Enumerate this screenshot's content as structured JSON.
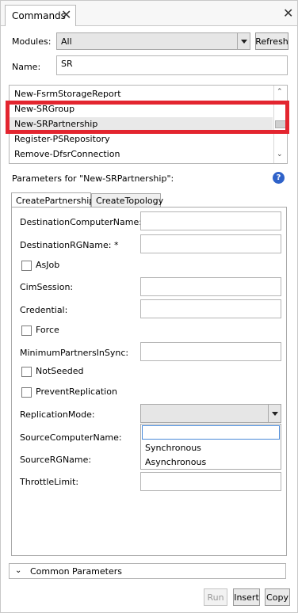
{
  "window": {
    "tab_label": "Commands",
    "tab_close_glyph": "✕",
    "close_glyph": "✕"
  },
  "modules": {
    "label": "Modules:",
    "value": "All",
    "refresh_label": "Refresh"
  },
  "name": {
    "label": "Name:",
    "value": "SR"
  },
  "command_list": {
    "items": [
      "New-FsrmStorageReport",
      "New-SRGroup",
      "New-SRPartnership",
      "Register-PSRepository",
      "Remove-DfsrConnection"
    ],
    "selected_index": 2,
    "scroll_up": "⌃",
    "scroll_down": "⌄"
  },
  "parameters": {
    "heading": "Parameters for \"New-SRPartnership\":",
    "help_glyph": "?",
    "tabs": [
      "CreatePartnership",
      "CreateTopology"
    ],
    "fields": {
      "destination_computer_name": "DestinationComputerName: *",
      "destination_rg_name": "DestinationRGName: *",
      "as_job": "AsJob",
      "cim_session": "CimSession:",
      "credential": "Credential:",
      "force": "Force",
      "minimum_partners_in_sync": "MinimumPartnersInSync:",
      "not_seeded": "NotSeeded",
      "prevent_replication": "PreventReplication",
      "replication_mode": "ReplicationMode:",
      "source_computer_name": "SourceComputerName:",
      "source_rg_name": "SourceRGName:",
      "throttle_limit": "ThrottleLimit:"
    },
    "replication_mode_options": [
      "Synchronous",
      "Asynchronous"
    ]
  },
  "common_parameters": {
    "label": "Common Parameters",
    "chevron": "⌄"
  },
  "actions": {
    "run": "Run",
    "insert": "Insert",
    "copy": "Copy"
  },
  "colors": {
    "highlight_box": "#e3252f",
    "help_icon": "#2f62c9"
  }
}
